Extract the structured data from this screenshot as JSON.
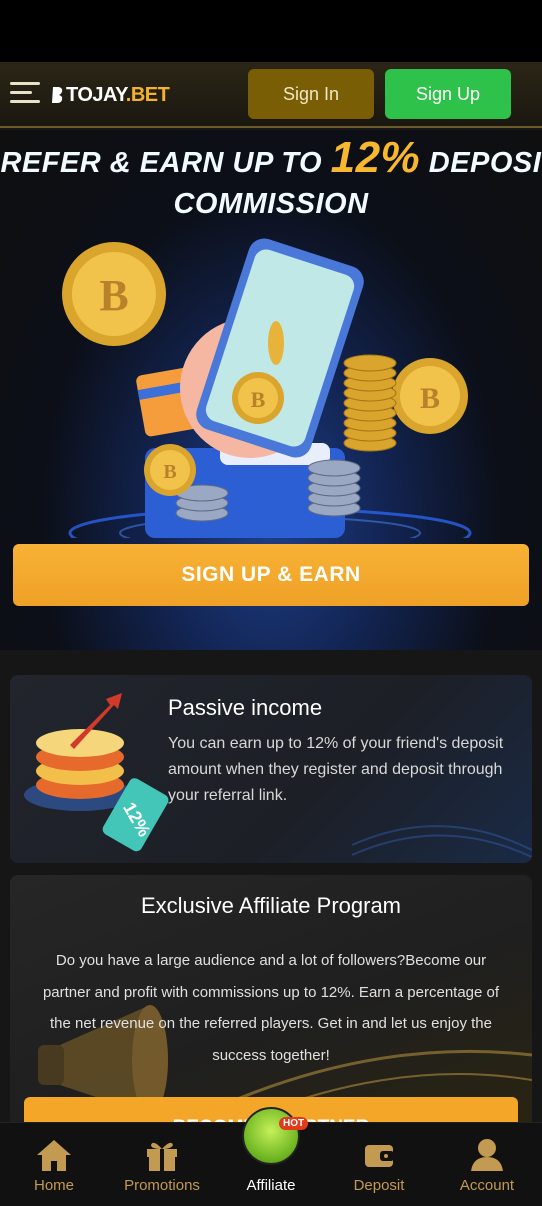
{
  "header": {
    "logo_text_1": "TOJAY",
    "logo_text_2": ".BET",
    "signin_label": "Sign In",
    "signup_label": "Sign Up",
    "menu_icon": "hamburger-menu-icon"
  },
  "hero": {
    "title_prefix": "REFER & EARN UP TO ",
    "title_highlight": "12%",
    "title_suffix": " DEPOSIT",
    "title_line2": "COMMISSION",
    "cta_label": "SIGN UP & EARN"
  },
  "passive": {
    "title": "Passive income",
    "text": "You can earn up to 12% of your friend's deposit amount when they register and deposit through your referral link.",
    "tag": "12%"
  },
  "affiliate_program": {
    "title": "Exclusive Affiliate Program",
    "text": "Do you have a large audience and a lot of followers?Become our partner and profit with commissions up to 12%. Earn a percentage of the net revenue on the referred players. Get in and let us enjoy the success together!",
    "button_label": "BECOME A PARTNER"
  },
  "nav": {
    "items": [
      {
        "label": "Home",
        "icon": "home-icon"
      },
      {
        "label": "Promotions",
        "icon": "gift-icon"
      },
      {
        "label": "Affiliate",
        "icon": "affiliate-icon",
        "badge": "HOT",
        "active": true
      },
      {
        "label": "Deposit",
        "icon": "wallet-icon"
      },
      {
        "label": "Account",
        "icon": "user-icon"
      }
    ]
  },
  "colors": {
    "accent_gold": "#f7b82f",
    "signup_green": "#2fc24a",
    "signin_gold": "#7a5e06",
    "cta_orange": "#f8b236",
    "nav_label": "#c29a52"
  }
}
